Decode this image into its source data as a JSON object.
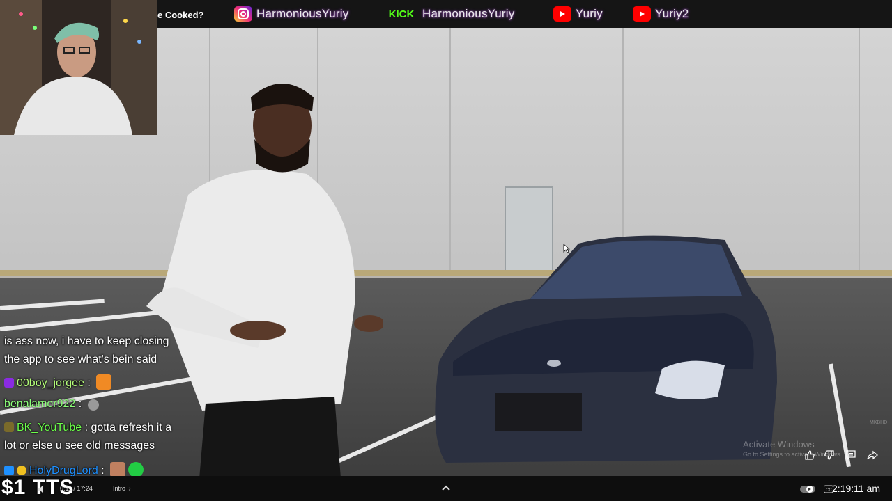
{
  "topbar": {
    "title": "e Cooked?",
    "socials": [
      {
        "icon": "instagram-icon",
        "handle": "HarmoniousYuriy",
        "color": "#c13584"
      },
      {
        "icon": "kick-icon",
        "handle": "HarmoniousYuriy",
        "color": "#53fc18"
      },
      {
        "icon": "youtube-icon",
        "handle": "Yuriy",
        "color": "#ff0000"
      },
      {
        "icon": "youtube-icon",
        "handle": "Yuriy2",
        "color": "#ff0000"
      }
    ],
    "kick_label": "KICK"
  },
  "chat": {
    "messages": [
      {
        "user": "",
        "text": "is ass now, i have to keep closing"
      },
      {
        "user": "",
        "text": "the app to see what's bein said"
      },
      {
        "user": "00boy_jorgee",
        "text": "",
        "user_color": "#b5ff7a"
      },
      {
        "user": "benalamer922",
        "text": "",
        "user_color": "#8dff7a"
      },
      {
        "user": "BK_YouTube",
        "text": "gotta refresh it a",
        "user_color": "#6cff4a"
      },
      {
        "user": "",
        "text": "lot or else u see old messages"
      },
      {
        "user": "HolyDrugLord",
        "text": "",
        "user_color": "#1e90ff"
      }
    ]
  },
  "watermark": {
    "line1": "Activate Windows",
    "line2": "Go to Settings to activate Windows.",
    "corner": "MKBHD"
  },
  "bottombar": {
    "tts": "$1 TTS",
    "time": "0:11 / 17:24",
    "chapter": "Intro",
    "clock": "2:19:11 am"
  }
}
